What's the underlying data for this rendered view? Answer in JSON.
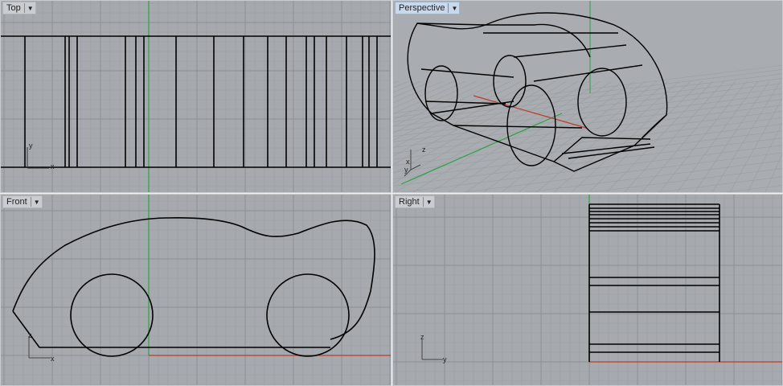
{
  "viewports": {
    "top": {
      "label": "Top"
    },
    "perspective": {
      "label": "Perspective"
    },
    "front": {
      "label": "Front"
    },
    "right": {
      "label": "Right"
    }
  },
  "icons": {
    "dropdown": "dropdown-arrow-icon"
  },
  "axes": {
    "top": {
      "a": "y",
      "b": "x"
    },
    "perspective": {
      "a": "z",
      "b": "x",
      "c": "y"
    },
    "front": {
      "a": "z",
      "b": "x"
    },
    "right": {
      "a": "z",
      "b": "y"
    }
  },
  "colors": {
    "viewport_bg": "#a6aaae",
    "grid_minor": "#9a9ea2",
    "grid_major": "#8c9094",
    "axis_x": "#c0392b",
    "axis_y": "#2ea043",
    "curve": "#000000",
    "active_tab": "#c9d8ea"
  }
}
